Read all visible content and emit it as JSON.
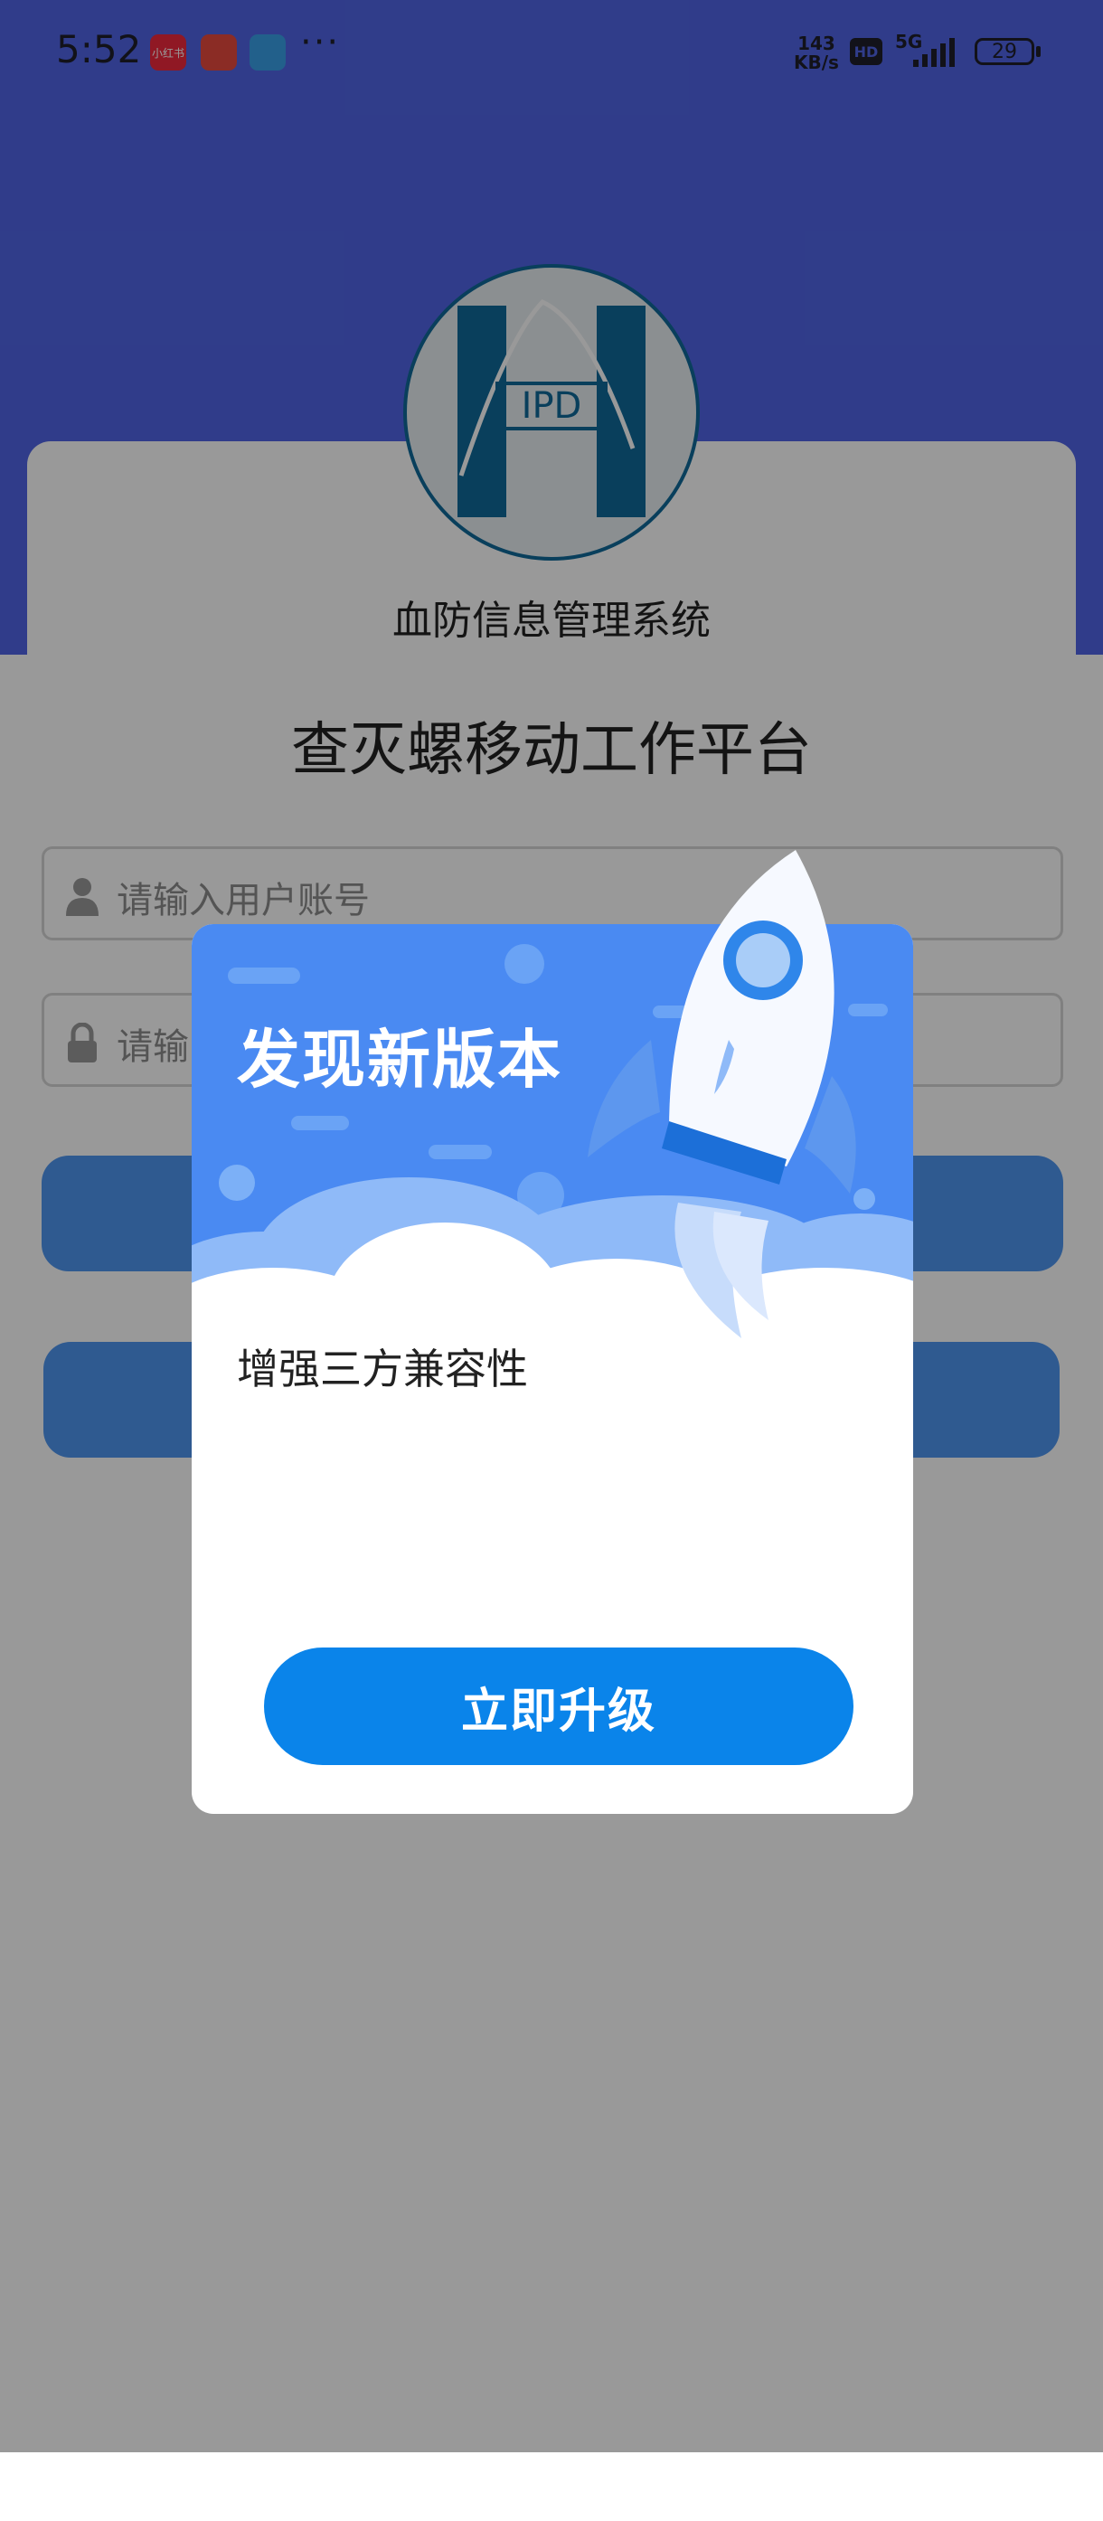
{
  "status": {
    "time": "5:52",
    "net_speed_value": "143",
    "net_speed_unit": "KB/s",
    "hd": "HD",
    "network": "5G",
    "battery": "29",
    "more": "···",
    "app_icon_1": "小红书"
  },
  "app": {
    "logo_text": "IPD",
    "system_name": "血防信息管理系统",
    "platform_title": "查灭螺移动工作平台",
    "username_placeholder": "请输入用户账号",
    "password_placeholder": "请输"
  },
  "dialog": {
    "title": "发现新版本",
    "message": "增强三方兼容性",
    "upgrade_label": "立即升级"
  }
}
